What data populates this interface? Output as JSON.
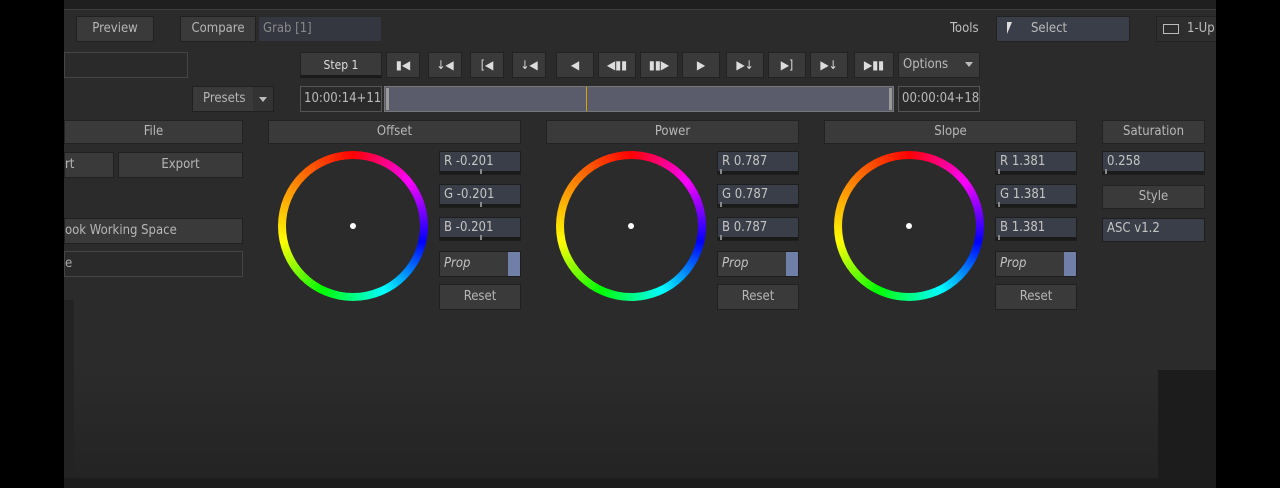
{
  "topbar": {
    "preview": "Preview",
    "compare": "Compare",
    "grab": "Grab [1]",
    "tools_label": "Tools",
    "select": "Select",
    "layout": "1-Up"
  },
  "transport": {
    "step": "Step 1",
    "options": "Options",
    "timecode_in": "10:00:14+11",
    "timecode_out": "00:00:04+18",
    "playhead_fraction": 0.395
  },
  "left_panel": {
    "presets": "Presets",
    "file_header": "File",
    "import_partial": "rt",
    "export": "Export",
    "working_space": "ook Working Space",
    "field_partial": "e"
  },
  "wheels": [
    {
      "header": "Offset",
      "r": "R -0.201",
      "g": "G -0.201",
      "b": "B -0.201",
      "prop": "Prop",
      "reset": "Reset"
    },
    {
      "header": "Power",
      "r": "R 0.787",
      "g": "G 0.787",
      "b": "B 0.787",
      "prop": "Prop",
      "reset": "Reset"
    },
    {
      "header": "Slope",
      "r": "R 1.381",
      "g": "G 1.381",
      "b": "B 1.381",
      "prop": "Prop",
      "reset": "Reset"
    }
  ],
  "saturation": {
    "header": "Saturation",
    "value": "0.258",
    "style_header": "Style",
    "style_value": "ASC v1.2"
  }
}
